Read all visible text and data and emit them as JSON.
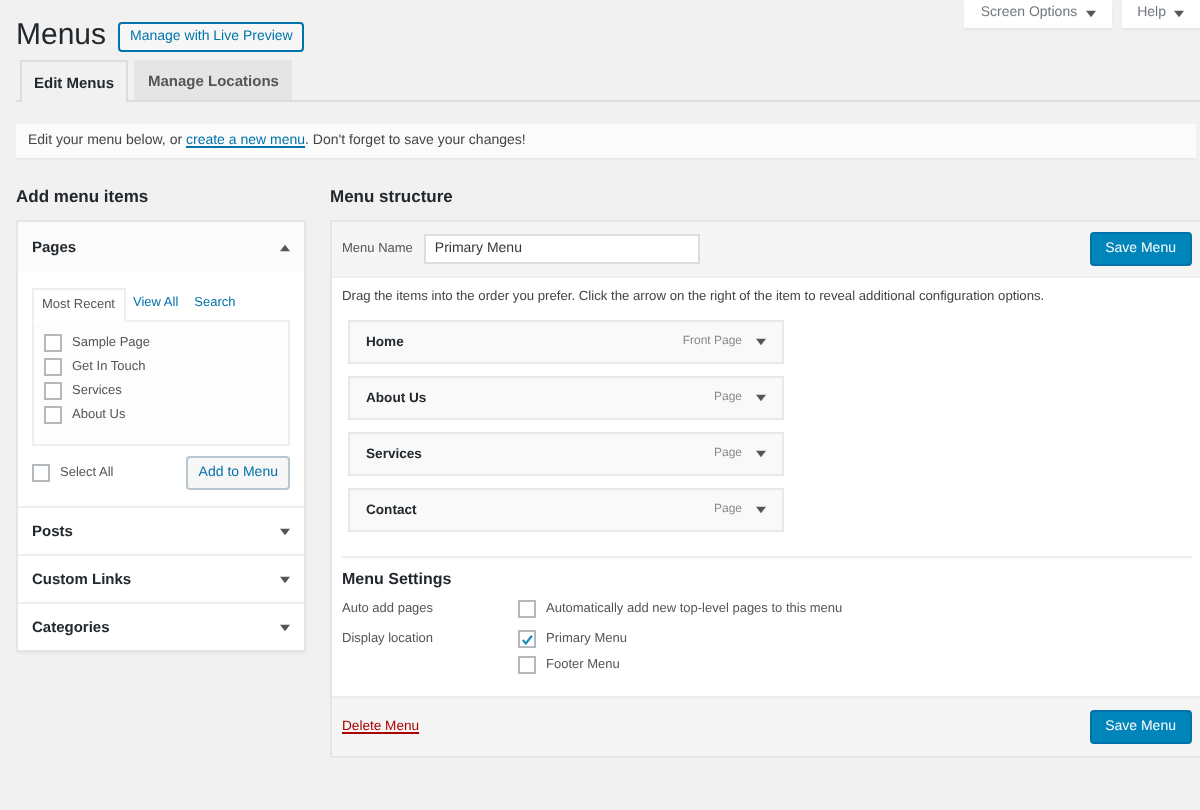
{
  "header": {
    "title": "Menus",
    "action": "Manage with Live Preview",
    "screen_options": "Screen Options",
    "help": "Help"
  },
  "tabs": [
    {
      "label": "Edit Menus",
      "selected": true
    },
    {
      "label": "Manage Locations",
      "selected": false
    }
  ],
  "notice": {
    "before": "Edit your menu below, or ",
    "link": "create a new menu",
    "after": ". Don't forget to save your changes!"
  },
  "add_items": {
    "heading": "Add menu items",
    "sections": [
      {
        "title": "Pages",
        "expanded": true,
        "tabs": [
          {
            "label": "Most Recent",
            "selected": true
          },
          {
            "label": "View All",
            "selected": false
          },
          {
            "label": "Search",
            "selected": false
          }
        ],
        "items": [
          {
            "label": "Sample Page",
            "checked": false
          },
          {
            "label": "Get In Touch",
            "checked": false
          },
          {
            "label": "Services",
            "checked": false
          },
          {
            "label": "About Us",
            "checked": false
          }
        ],
        "select_all": {
          "label": "Select All",
          "checked": false
        },
        "button": "Add to Menu"
      },
      {
        "title": "Posts",
        "expanded": false
      },
      {
        "title": "Custom Links",
        "expanded": false
      },
      {
        "title": "Categories",
        "expanded": false
      }
    ]
  },
  "structure": {
    "heading": "Menu structure",
    "name_label": "Menu Name",
    "name_value": "Primary Menu",
    "save": "Save Menu",
    "instructions": "Drag the items into the order you prefer. Click the arrow on the right of the item to reveal additional configuration options.",
    "items": [
      {
        "title": "Home",
        "type": "Front Page"
      },
      {
        "title": "About Us",
        "type": "Page"
      },
      {
        "title": "Services",
        "type": "Page"
      },
      {
        "title": "Contact",
        "type": "Page"
      }
    ],
    "settings": {
      "heading": "Menu Settings",
      "rows": [
        {
          "label": "Auto add pages",
          "options": [
            {
              "label": "Automatically add new top-level pages to this menu",
              "checked": false
            }
          ]
        },
        {
          "label": "Display location",
          "options": [
            {
              "label": "Primary Menu",
              "checked": true
            },
            {
              "label": "Footer Menu",
              "checked": false
            }
          ]
        }
      ]
    },
    "delete": "Delete Menu",
    "save_bottom": "Save Menu"
  }
}
